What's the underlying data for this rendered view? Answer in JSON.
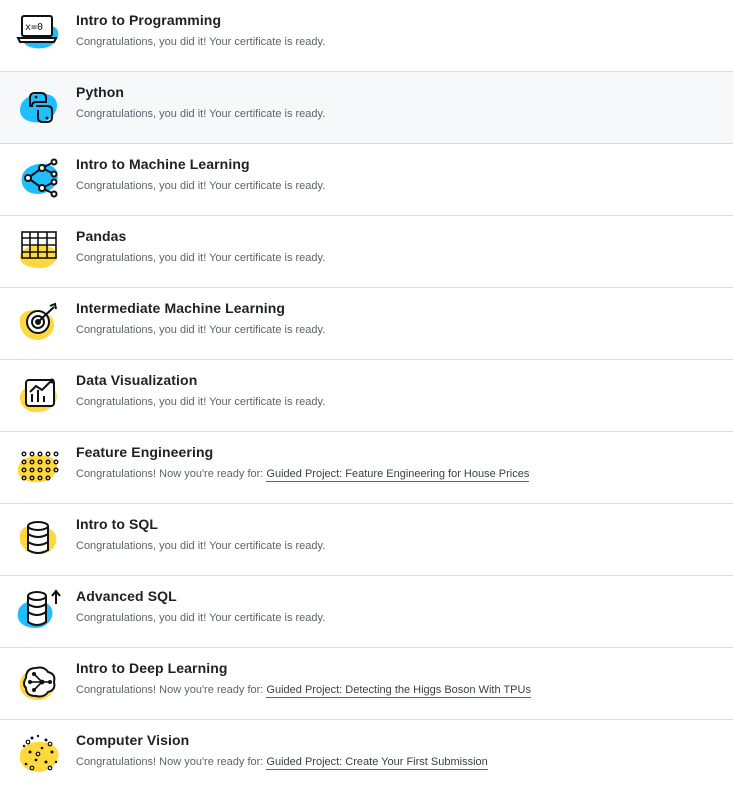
{
  "courses": [
    {
      "title": "Intro to Programming",
      "status": "Congratulations, you did it! Your certificate is ready.",
      "icon": "laptop-code-icon",
      "blob": "#20beff"
    },
    {
      "title": "Python",
      "status": "Congratulations, you did it! Your certificate is ready.",
      "icon": "python-logo-icon",
      "blob": "#20beff"
    },
    {
      "title": "Intro to Machine Learning",
      "status": "Congratulations, you did it! Your certificate is ready.",
      "icon": "decision-tree-icon",
      "blob": "#20beff"
    },
    {
      "title": "Pandas",
      "status": "Congratulations, you did it! Your certificate is ready.",
      "icon": "dataframe-grid-icon",
      "blob": "#ffd83d"
    },
    {
      "title": "Intermediate Machine Learning",
      "status": "Congratulations, you did it! Your certificate is ready.",
      "icon": "target-icon",
      "blob": "#ffd83d"
    },
    {
      "title": "Data Visualization",
      "status": "Congratulations, you did it! Your certificate is ready.",
      "icon": "chart-icon",
      "blob": "#ffd83d"
    },
    {
      "title": "Feature Engineering",
      "status": "Congratulations! Now you're ready for: ",
      "link": "Guided Project: Feature Engineering for House Prices",
      "icon": "dot-grid-icon",
      "blob": "#ffd83d"
    },
    {
      "title": "Intro to SQL",
      "status": "Congratulations, you did it! Your certificate is ready.",
      "icon": "database-icon",
      "blob": "#ffd83d"
    },
    {
      "title": "Advanced SQL",
      "status": "Congratulations, you did it! Your certificate is ready.",
      "icon": "database-up-icon",
      "blob": "#20beff"
    },
    {
      "title": "Intro to Deep Learning",
      "status": "Congratulations! Now you're ready for: ",
      "link": "Guided Project: Detecting the Higgs Boson With TPUs",
      "icon": "neural-brain-icon",
      "blob": "#ffd83d"
    },
    {
      "title": "Computer Vision",
      "status": "Congratulations! Now you're ready for: ",
      "link": "Guided Project: Create Your First Submission",
      "icon": "particles-icon",
      "blob": "#ffd83d"
    }
  ]
}
